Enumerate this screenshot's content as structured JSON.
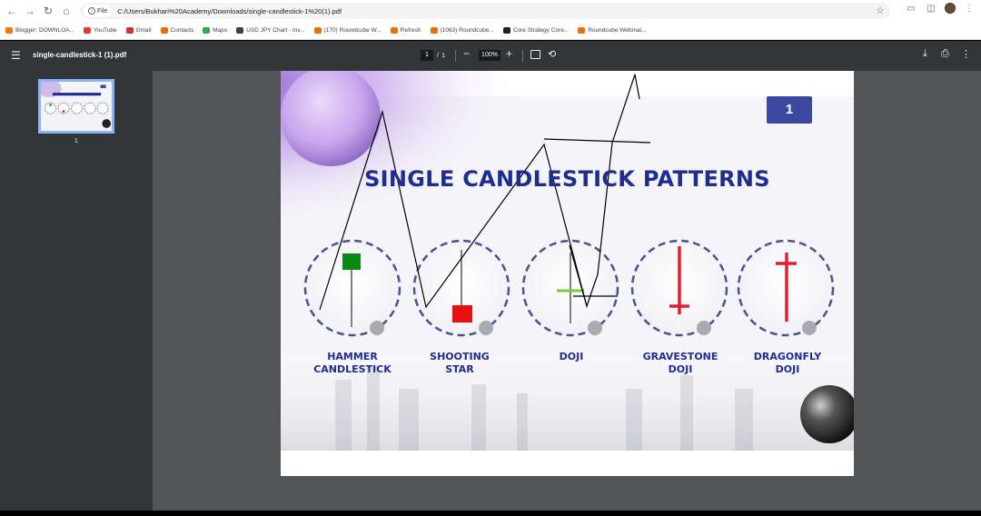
{
  "browser": {
    "file_chip_label": "File",
    "url": "C:/Users/Bukhari%20Academy/Downloads/single-candlestick-1%20(1).pdf",
    "bookmarks": [
      {
        "label": "Blogger: DOWNLOA...",
        "color": "#f57c00"
      },
      {
        "label": "YouTube",
        "color": "#e53935"
      },
      {
        "label": "Gmail",
        "color": "#d93025"
      },
      {
        "label": "Contacts",
        "color": "#e8710a"
      },
      {
        "label": "Maps",
        "color": "#34a853"
      },
      {
        "label": "USD JPY Chart - Inv...",
        "color": "#3c4043"
      },
      {
        "label": "(170) Roundcube W...",
        "color": "#e8710a"
      },
      {
        "label": "Refresh",
        "color": "#e8710a"
      },
      {
        "label": "(1063) Roundcube...",
        "color": "#e8710a"
      },
      {
        "label": "Core Strategy Core...",
        "color": "#202124"
      },
      {
        "label": "Roundcube Webmai...",
        "color": "#e8710a"
      }
    ]
  },
  "pdf_viewer": {
    "title": "single-candlestick-1 (1).pdf",
    "current_page": "1",
    "page_separator": "/",
    "total_pages": "1",
    "zoom": "100%",
    "thumbnail_label": "1"
  },
  "slide": {
    "title": "SINGLE CANDLESTICK PATTERNS",
    "page_badge": "1",
    "patterns": [
      {
        "line1": "HAMMER",
        "line2": "CANDLESTICK"
      },
      {
        "line1": "SHOOTING",
        "line2": "STAR"
      },
      {
        "line1": "DOJI",
        "line2": ""
      },
      {
        "line1": "GRAVESTONE",
        "line2": "DOJI"
      },
      {
        "line1": "DRAGONFLY",
        "line2": "DOJI"
      }
    ],
    "colors": {
      "title": "#1e2d8f",
      "bullish": "#0a8a12",
      "bearish": "#e81010",
      "doji_mark": "#7ac943",
      "dash_ring": "#4a5290"
    }
  }
}
